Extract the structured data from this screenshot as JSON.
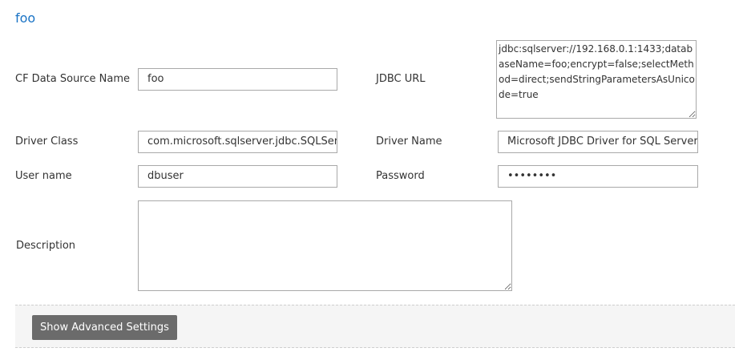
{
  "form": {
    "title": "foo",
    "datasource_name": {
      "label": "CF Data Source Name",
      "value": "foo"
    },
    "jdbc_url": {
      "label": "JDBC URL",
      "value": "jdbc:sqlserver://192.168.0.1:1433;databaseName=foo;encrypt=false;selectMethod=direct;sendStringParametersAsUnicode=true"
    },
    "driver_class": {
      "label": "Driver Class",
      "value": "com.microsoft.sqlserver.jdbc.SQLServerDriver"
    },
    "driver_name": {
      "label": "Driver Name",
      "value": "Microsoft JDBC Driver for SQL Server"
    },
    "username": {
      "label": "User name",
      "value": "dbuser"
    },
    "password": {
      "label": "Password",
      "value": "••••••••"
    },
    "description": {
      "label": "Description",
      "value": ""
    },
    "advanced_button": "Show Advanced Settings"
  },
  "colors": {
    "title": "#1a73c5",
    "button_bg": "#6b6b6b",
    "bar_bg": "#f5f5f5"
  }
}
